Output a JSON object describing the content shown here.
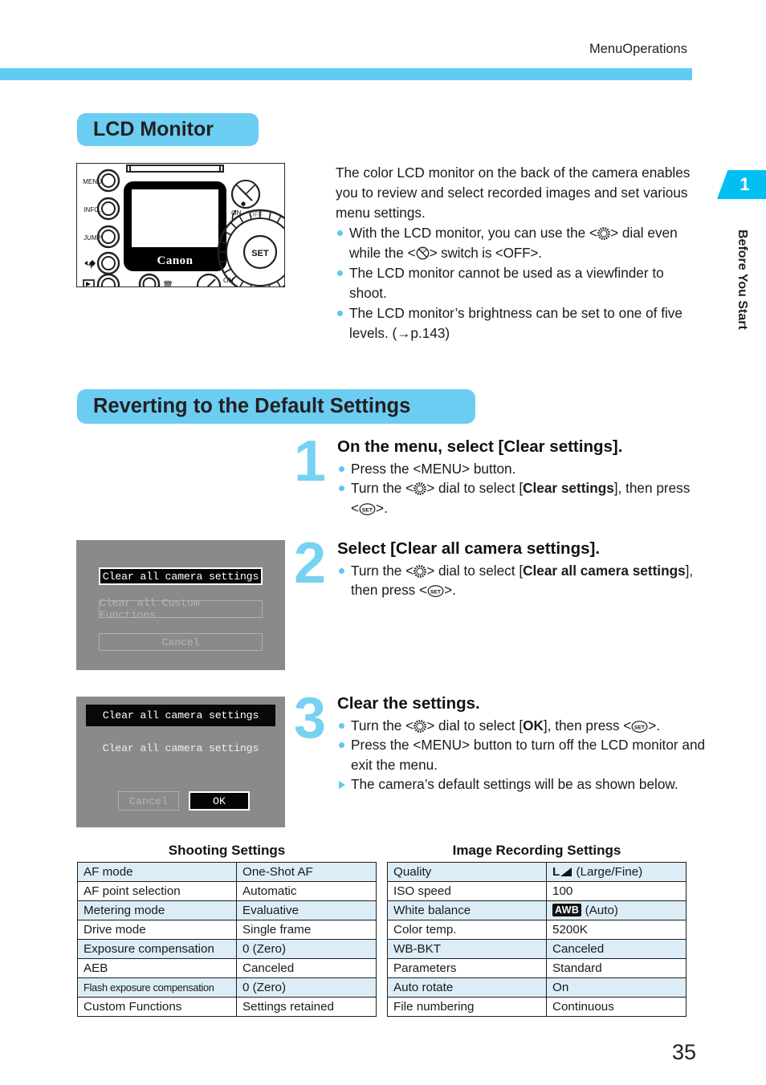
{
  "header": {
    "running_head": "MenuOperations"
  },
  "side_tab": {
    "number": "1",
    "label": "Before You Start"
  },
  "sections": {
    "lcd_monitor": {
      "title": "LCD Monitor",
      "intro": "The color LCD monitor on the back of the camera enables you to review and select recorded images and set various menu settings.",
      "bullets": [
        {
          "pre": "With the LCD monitor, you can use the <",
          "icon1": "dial-icon",
          "mid": "> dial even while the <",
          "icon2": "power-switch-icon",
          "post": "> switch is <OFF>."
        },
        {
          "text": "The LCD monitor cannot be used as a viewfinder to shoot."
        },
        {
          "text": "The LCD monitor’s brightness can be set to one of five levels. (→p.143)"
        }
      ],
      "camera_labels": {
        "menu": "MENU",
        "info": "INFO.",
        "jump": "JUMP",
        "set": "SET",
        "on": "ON",
        "off": "OFF",
        "on2": "ON",
        "brand": "Canon"
      }
    },
    "reverting": {
      "title": "Reverting to the Default Settings",
      "steps": [
        {
          "number": "1",
          "heading": "On the menu, select [Clear settings].",
          "bullets": [
            {
              "parts": [
                "Press the <MENU> button."
              ]
            },
            {
              "parts": [
                "Turn the <",
                "DIAL",
                "> dial to select [",
                "B:Clear settings",
                "], then press <",
                "SET",
                ">."
              ]
            }
          ]
        },
        {
          "number": "2",
          "heading": "Select [Clear all camera settings].",
          "bullets": [
            {
              "parts": [
                "Turn the <",
                "DIAL",
                "> dial to select [",
                "B:Clear all camera settings",
                "], then press <",
                "SET",
                ">."
              ]
            }
          ]
        },
        {
          "number": "3",
          "heading": "Clear the settings.",
          "bullets": [
            {
              "parts": [
                "Turn the <",
                "DIAL",
                "> dial to select [",
                "B:OK",
                "], then press <",
                "SET",
                ">."
              ]
            },
            {
              "parts": [
                "Press the <MENU> button to turn off the LCD monitor and exit the menu."
              ]
            },
            {
              "parts": [
                "The camera’s default settings will be as shown below."
              ],
              "marker": "triangle"
            }
          ]
        }
      ],
      "lcd_screen_1": {
        "items": [
          {
            "label": "Clear all camera settings",
            "state": "selected"
          },
          {
            "label": "Clear all Custom Functions",
            "state": "dim"
          },
          {
            "label": "Cancel",
            "state": "dim"
          }
        ]
      },
      "lcd_screen_2": {
        "title": "Clear all camera settings",
        "message": "Clear all camera settings",
        "buttons": [
          {
            "label": "Cancel",
            "state": "dim"
          },
          {
            "label": "OK",
            "state": "selected"
          }
        ]
      }
    }
  },
  "tables": {
    "shooting": {
      "title": "Shooting Settings",
      "rows": [
        {
          "key": "AF mode",
          "value": "One-Shot AF"
        },
        {
          "key": "AF point selection",
          "value": "Automatic"
        },
        {
          "key": "Metering mode",
          "value": "Evaluative"
        },
        {
          "key": "Drive mode",
          "value": "Single frame"
        },
        {
          "key": "Exposure compensation",
          "value": "0 (Zero)"
        },
        {
          "key": "AEB",
          "value": "Canceled"
        },
        {
          "key": "Flash exposure compensation",
          "value": "0 (Zero)"
        },
        {
          "key": "Custom Functions",
          "value": "Settings retained"
        }
      ]
    },
    "image_recording": {
      "title": "Image Recording Settings",
      "rows": [
        {
          "key": "Quality",
          "value": "(Large/Fine)",
          "prefix": "L",
          "icon": "quality-fine-icon"
        },
        {
          "key": "ISO speed",
          "value": "100"
        },
        {
          "key": "White balance",
          "value": "(Auto)",
          "badge": "AWB"
        },
        {
          "key": "Color temp.",
          "value": "5200K"
        },
        {
          "key": "WB-BKT",
          "value": "Canceled"
        },
        {
          "key": "Parameters",
          "value": "Standard"
        },
        {
          "key": "Auto rotate",
          "value": "On"
        },
        {
          "key": "File numbering",
          "value": "Continuous"
        }
      ]
    }
  },
  "footer": {
    "page_number": "35"
  },
  "colors": {
    "accent_blue": "#6bcdf2",
    "tab_blue": "#00bff3",
    "table_alt": "#dcedf8",
    "bullet_blue": "#5cc8ef",
    "lcd_gray": "#8a8a8a"
  }
}
